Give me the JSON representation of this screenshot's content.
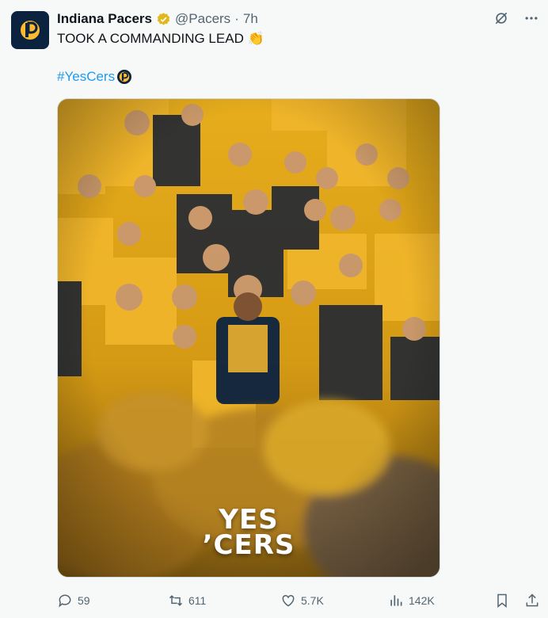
{
  "post": {
    "author": {
      "name": "Indiana Pacers",
      "handle": "@Pacers",
      "separator": "·",
      "time": "7h"
    },
    "text": "TOOK A COMMANDING LEAD 👏",
    "hashtag": "#YesCers",
    "media": {
      "overlay_line1": "YES",
      "overlay_line2": "’CERS"
    },
    "stats": {
      "replies": "59",
      "reposts": "611",
      "likes": "5.7K",
      "views": "142K"
    }
  },
  "colors": {
    "link": "#1d9bf0",
    "muted": "#536471",
    "navy": "#0c2340",
    "gold": "#fdbb30"
  },
  "icons": [
    "verified-badge-icon",
    "grok-icon",
    "more-icon",
    "reply-icon",
    "repost-icon",
    "like-icon",
    "views-icon",
    "bookmark-icon",
    "share-icon",
    "clap-emoji",
    "pacers-logo"
  ]
}
